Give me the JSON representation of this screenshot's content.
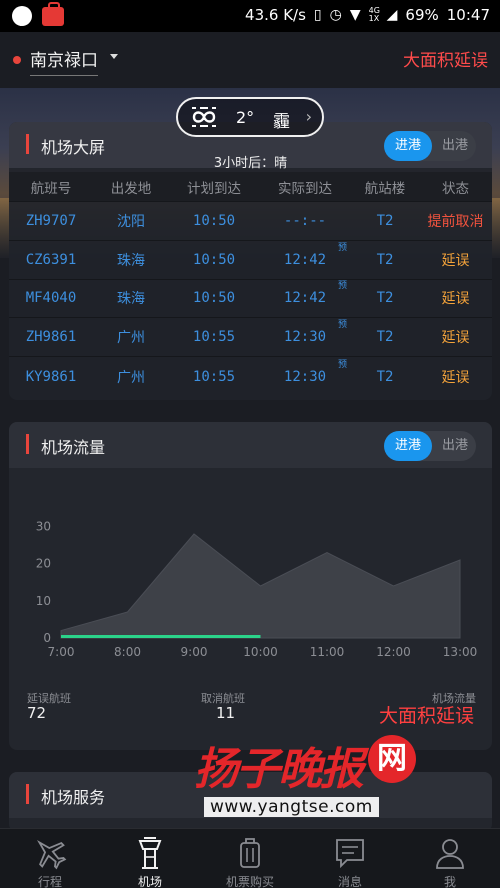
{
  "status_bar": {
    "net_speed": "43.6 K/s",
    "network_tag_top": "4G",
    "network_tag_bottom": "1X",
    "battery": "69%",
    "time": "10:47",
    "icons": [
      "chat-bubble-icon",
      "bag-icon",
      "vibrate-icon",
      "alarm-icon",
      "wifi-icon",
      "signal-icon",
      "battery-icon"
    ]
  },
  "header": {
    "location": "南京禄口",
    "alert": "大面积延误"
  },
  "weather": {
    "temperature": "2°",
    "condition": "霾",
    "forecast": "3小时后：晴",
    "icon": "haze-icon"
  },
  "board": {
    "title": "机场大屏",
    "toggle_active": "进港",
    "toggle_inactive": "出港",
    "columns": [
      "航班号",
      "出发地",
      "计划到达",
      "实际到达",
      "航站楼",
      "状态"
    ],
    "rows": [
      {
        "flight": "ZH9707",
        "origin": "沈阳",
        "planned": "10:50",
        "actual": "--:--",
        "tag": "",
        "terminal": "T2",
        "status": "提前取消",
        "status_type": "cancel"
      },
      {
        "flight": "CZ6391",
        "origin": "珠海",
        "planned": "10:50",
        "actual": "12:42",
        "tag": "预",
        "terminal": "T2",
        "status": "延误",
        "status_type": "delay"
      },
      {
        "flight": "MF4040",
        "origin": "珠海",
        "planned": "10:50",
        "actual": "12:42",
        "tag": "预",
        "terminal": "T2",
        "status": "延误",
        "status_type": "delay"
      },
      {
        "flight": "ZH9861",
        "origin": "广州",
        "planned": "10:55",
        "actual": "12:30",
        "tag": "预",
        "terminal": "T2",
        "status": "延误",
        "status_type": "delay"
      },
      {
        "flight": "KY9861",
        "origin": "广州",
        "planned": "10:55",
        "actual": "12:30",
        "tag": "预",
        "terminal": "T2",
        "status": "延误",
        "status_type": "delay"
      }
    ]
  },
  "flow": {
    "title": "机场流量",
    "toggle_active": "进港",
    "toggle_inactive": "出港",
    "stats": [
      {
        "label": "延误航班",
        "value": "72"
      },
      {
        "label": "取消航班",
        "value": "11"
      },
      {
        "label": "机场流量",
        "value": "大面积延误"
      }
    ]
  },
  "chart_data": {
    "type": "area",
    "x": [
      "7:00",
      "8:00",
      "9:00",
      "10:00",
      "11:00",
      "12:00",
      "13:00"
    ],
    "series": [
      {
        "values": [
          2,
          7,
          28,
          14,
          23,
          14,
          21
        ],
        "color": "#3e4148"
      },
      {
        "values": [
          0,
          0,
          0,
          0
        ],
        "color": "#2bd38a"
      }
    ],
    "yticks": [
      0,
      10,
      20,
      30
    ],
    "ylim": [
      0,
      35
    ],
    "grid": false
  },
  "services": {
    "title": "机场服务"
  },
  "watermark": {
    "brand": "扬子晚报",
    "badge": "网",
    "url": "www.yangtse.com"
  },
  "nav": [
    {
      "label": "行程",
      "icon": "plane-icon",
      "active": false
    },
    {
      "label": "机场",
      "icon": "control-tower-icon",
      "active": true
    },
    {
      "label": "机票购买",
      "icon": "luggage-icon",
      "active": false
    },
    {
      "label": "消息",
      "icon": "message-icon",
      "active": false
    },
    {
      "label": "我",
      "icon": "person-icon",
      "active": false
    }
  ],
  "colors": {
    "accent_blue": "#1a96ee",
    "alert_red": "#ff4b4b",
    "delay_orange": "#f4a33a",
    "cancel_red": "#f1533e",
    "flight_blue": "#3d8fde"
  }
}
